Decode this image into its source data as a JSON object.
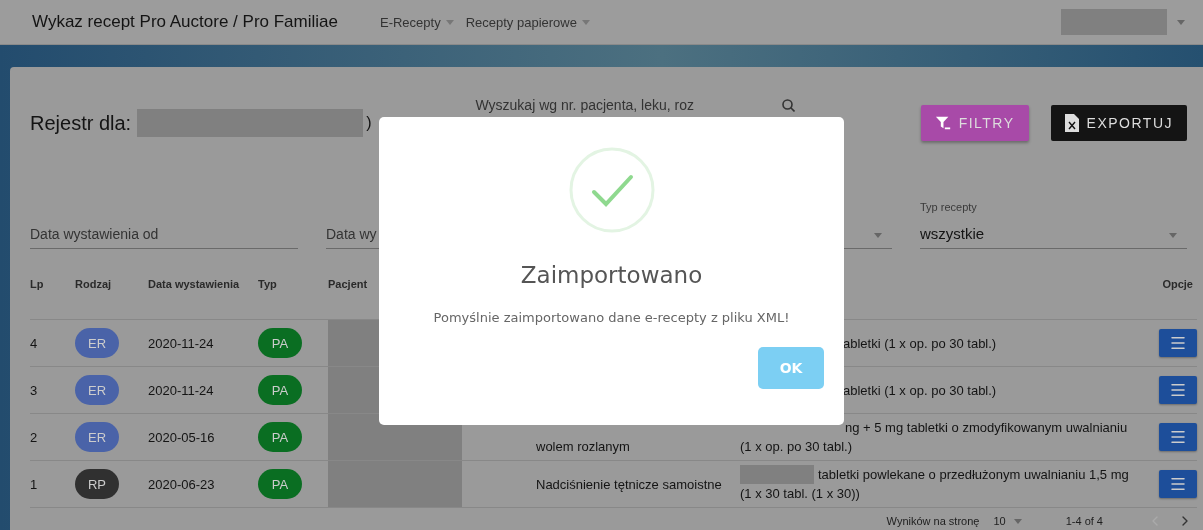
{
  "topbar": {
    "title": "Wykaz recept Pro Auctore / Pro Familiae",
    "menus": [
      {
        "label": "E-Recepty"
      },
      {
        "label": "Recepty papierowe"
      }
    ]
  },
  "register": {
    "label": "Rejestr dla:",
    "suffix": ")",
    "search": {
      "placeholder": "Wyszukaj wg nr. pacjenta, leku, roz"
    },
    "buttons": [
      {
        "kind": "filter",
        "label": "FILTRY"
      },
      {
        "kind": "export",
        "label": "EXPORTUJ"
      }
    ]
  },
  "filters": [
    {
      "kind": "date",
      "placeholder": "Data wystawienia od"
    },
    {
      "kind": "date",
      "placeholder": "Data wy"
    },
    {
      "kind": "select"
    },
    {
      "kind": "select",
      "label": "Typ recepty",
      "value": "wszystkie"
    }
  ],
  "table": {
    "columns": [
      "Lp",
      "Rodzaj",
      "Data wystawienia",
      "Typ",
      "Pacjent",
      "Opcje"
    ],
    "rows": [
      {
        "lp": "4",
        "kind": {
          "label": "ER",
          "color": "#4a63a8"
        },
        "date": "2020-11-24",
        "type": {
          "label": "PA",
          "color": "#0a6e22"
        },
        "medicine": "abletki (1 x op. po 30 tabl.)",
        "medicine_redacted": false
      },
      {
        "lp": "3",
        "kind": {
          "label": "ER",
          "color": "#4a63a8"
        },
        "date": "2020-11-24",
        "type": {
          "label": "PA",
          "color": "#0a6e22"
        },
        "medicine": "abletki (1 x op. po 30 tabl.)",
        "medicine_redacted": false
      },
      {
        "lp": "2",
        "kind": {
          "label": "ER",
          "color": "#4a63a8"
        },
        "date": "2020-05-16",
        "type": {
          "label": "PA",
          "color": "#0a6e22"
        },
        "diagnosis": "wolem rozlanym",
        "medicine": "ng + 5 mg tabletki o zmodyfikowanym uwalnianiu (1 x op. po 30 tabl.)",
        "medicine_redacted": false
      },
      {
        "lp": "1",
        "kind": {
          "label": "RP",
          "color": "#303030"
        },
        "date": "2020-06-23",
        "type": {
          "label": "PA",
          "color": "#0a6e22"
        },
        "diagnosis": "Nadciśnienie tętnicze samoistne",
        "medicine": "tabletki powlekane o przedłużonym uwalnianiu 1,5 mg (1 x 30 tabl. (1 x 30))",
        "medicine_redacted": true
      }
    ]
  },
  "pagination": {
    "rows_label": "Wyników na stronę",
    "rows_value": "10",
    "range": "1-4 of 4"
  },
  "modal": {
    "title": "Zaimportowano",
    "message": "Pomyślnie zaimportowano dane e-recepty z pliku XML!",
    "button": "OK"
  }
}
